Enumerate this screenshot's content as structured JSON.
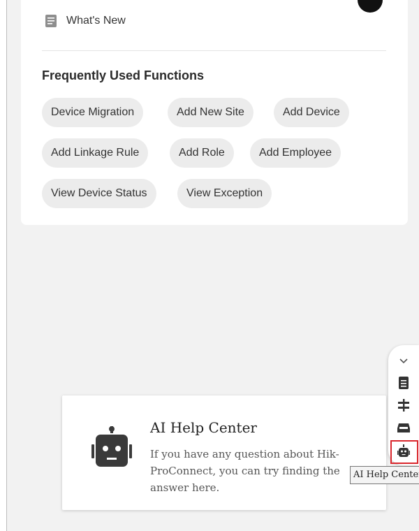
{
  "menu": {
    "whats_new": "What's New"
  },
  "frequently_used": {
    "title": "Frequently Used Functions",
    "items": [
      "Device Migration",
      "Add New Site",
      "Add Device",
      "Add Linkage Rule",
      "Add Role",
      "Add Employee",
      "View Device Status",
      "View Exception"
    ]
  },
  "help_card": {
    "title": "AI Help Center",
    "description": "If you have any question about Hik-ProConnect, you can try finding the answer here."
  },
  "side_toolbar": {
    "icons": [
      "chevron-down-icon",
      "document-icon",
      "signpost-icon",
      "inbox-icon",
      "robot-icon"
    ],
    "tooltip": "AI Help Center"
  },
  "colors": {
    "highlight": "#d9262c",
    "chip_bg": "#ececec",
    "icon": "#3a3a3a"
  }
}
